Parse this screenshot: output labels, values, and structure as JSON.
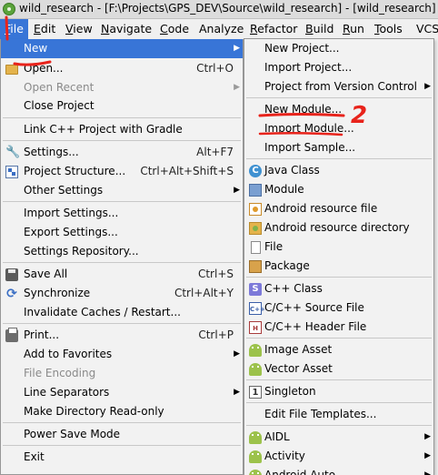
{
  "window": {
    "title": "wild_research - [F:\\Projects\\GPS_DEV\\Source\\wild_research] - [wild_research] - ..."
  },
  "menubar": [
    {
      "label": "File",
      "mnemonic": "F",
      "rest": "ile"
    },
    {
      "label": "Edit",
      "mnemonic": "E",
      "rest": "dit"
    },
    {
      "label": "View",
      "mnemonic": "V",
      "rest": "iew"
    },
    {
      "label": "Navigate",
      "mnemonic": "N",
      "rest": "avigate"
    },
    {
      "label": "Code",
      "mnemonic": "C",
      "rest": "ode"
    },
    {
      "label": "Analyze",
      "mnemonic": "",
      "rest": "Analyze"
    },
    {
      "label": "Refactor",
      "mnemonic": "R",
      "rest": "efactor"
    },
    {
      "label": "Build",
      "mnemonic": "B",
      "rest": "uild"
    },
    {
      "label": "Run",
      "mnemonic": "R",
      "rest": "un"
    },
    {
      "label": "Tools",
      "mnemonic": "T",
      "rest": "ools"
    },
    {
      "label": "VCS",
      "mnemonic": "",
      "rest": "VCS"
    }
  ],
  "file_menu": {
    "new": "New",
    "open": "Open...",
    "open_sc": "Ctrl+O",
    "open_recent": "Open Recent",
    "close_project": "Close Project",
    "link_cpp": "Link C++ Project with Gradle",
    "settings": "Settings...",
    "settings_sc": "Alt+F7",
    "project_structure": "Project Structure...",
    "project_structure_sc": "Ctrl+Alt+Shift+S",
    "other_settings": "Other Settings",
    "import_settings": "Import Settings...",
    "export_settings": "Export Settings...",
    "settings_repo": "Settings Repository...",
    "save_all": "Save All",
    "save_all_sc": "Ctrl+S",
    "synchronize": "Synchronize",
    "synchronize_sc": "Ctrl+Alt+Y",
    "invalidate": "Invalidate Caches / Restart...",
    "print": "Print...",
    "print_sc": "Ctrl+P",
    "favorites": "Add to Favorites",
    "file_encoding": "File Encoding",
    "line_separators": "Line Separators",
    "make_readonly": "Make Directory Read-only",
    "power_save": "Power Save Mode",
    "exit": "Exit"
  },
  "new_submenu": {
    "new_project": "New Project...",
    "import_project": "Import Project...",
    "project_from_vcs": "Project from Version Control",
    "new_module": "New Module...",
    "import_module": "Import Module...",
    "import_sample": "Import Sample...",
    "java_class": "Java Class",
    "module": "Module",
    "android_resource_file": "Android resource file",
    "android_resource_dir": "Android resource directory",
    "file": "File",
    "package": "Package",
    "cpp_class": "C++ Class",
    "cpp_source": "C/C++ Source File",
    "cpp_header": "C/C++ Header File",
    "image_asset": "Image Asset",
    "vector_asset": "Vector Asset",
    "singleton": "Singleton",
    "edit_templates": "Edit File Templates...",
    "aidl": "AIDL",
    "activity": "Activity",
    "android_auto": "Android Auto"
  },
  "annotations": {
    "mark_2": "2"
  },
  "colors": {
    "highlight": "#3875d7",
    "annotation": "#e8231b",
    "menu_bg": "#f2f2f2"
  },
  "icons": [
    "app-icon",
    "folder-icon",
    "gear-icon",
    "project-structure-icon",
    "save-icon",
    "sync-icon",
    "print-icon",
    "java-class-icon",
    "module-icon",
    "android-resource-file-icon",
    "android-resource-dir-icon",
    "file-icon",
    "package-icon",
    "cpp-class-icon",
    "cpp-source-icon",
    "cpp-header-icon",
    "android-icon",
    "singleton-icon"
  ]
}
